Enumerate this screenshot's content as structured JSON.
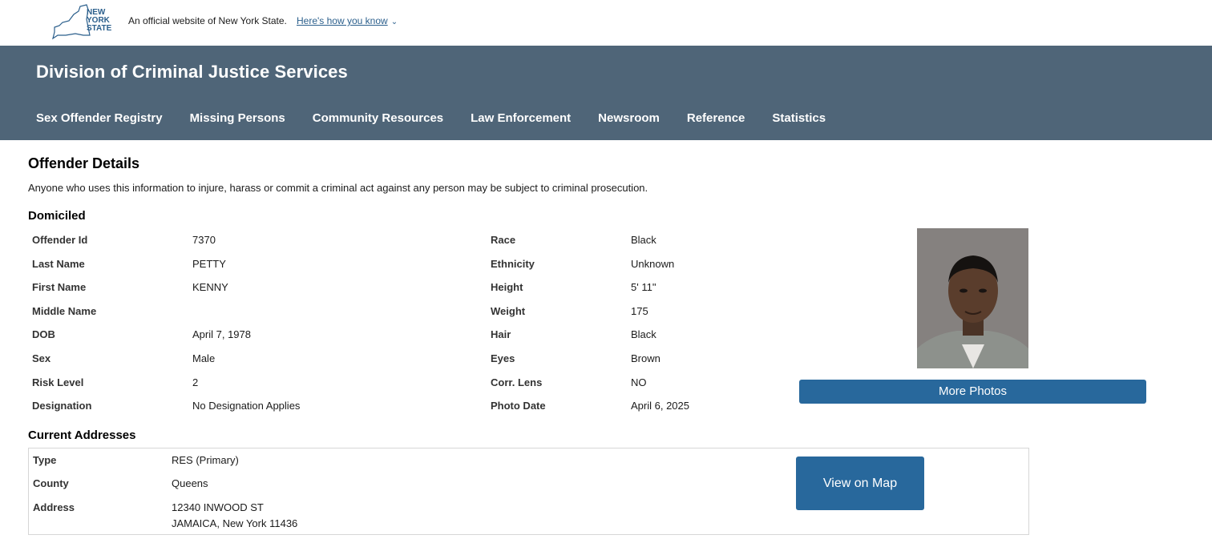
{
  "banner": {
    "logo_text": "NEW YORK STATE",
    "official_text": "An official website of New York State.",
    "how_know_link": "Here's how you know"
  },
  "header": {
    "agency_title": "Division of Criminal Justice Services",
    "nav": [
      "Sex Offender Registry",
      "Missing Persons",
      "Community Resources",
      "Law Enforcement",
      "Newsroom",
      "Reference",
      "Statistics"
    ]
  },
  "main": {
    "title": "Offender Details",
    "warning": "Anyone who uses this information to injure, harass or commit a criminal act against any person may be subject to criminal prosecution.",
    "domiciled_heading": "Domiciled",
    "left_details": [
      {
        "label": "Offender Id",
        "value": "7370"
      },
      {
        "label": "Last Name",
        "value": "PETTY"
      },
      {
        "label": "First Name",
        "value": "KENNY"
      },
      {
        "label": "Middle Name",
        "value": ""
      },
      {
        "label": "DOB",
        "value": "April 7, 1978"
      },
      {
        "label": "Sex",
        "value": "Male"
      },
      {
        "label": "Risk Level",
        "value": "2"
      },
      {
        "label": "Designation",
        "value": "No Designation Applies"
      }
    ],
    "right_details": [
      {
        "label": "Race",
        "value": "Black"
      },
      {
        "label": "Ethnicity",
        "value": "Unknown"
      },
      {
        "label": "Height",
        "value": "5' 11\""
      },
      {
        "label": "Weight",
        "value": "175"
      },
      {
        "label": "Hair",
        "value": "Black"
      },
      {
        "label": "Eyes",
        "value": "Brown"
      },
      {
        "label": "Corr. Lens",
        "value": "NO"
      },
      {
        "label": "Photo Date",
        "value": "April 6, 2025"
      }
    ],
    "more_photos_button": "More Photos",
    "addresses_heading": "Current Addresses",
    "address": {
      "type_label": "Type",
      "type_value": "RES (Primary)",
      "county_label": "County",
      "county_value": "Queens",
      "address_label": "Address",
      "address_line1": "12340 INWOOD ST",
      "address_line2": "JAMAICA, New York 11436"
    },
    "view_map_button": "View on Map"
  },
  "colors": {
    "header_bg": "#4f6578",
    "button_bg": "#28689c",
    "link": "#2b5f8c"
  }
}
